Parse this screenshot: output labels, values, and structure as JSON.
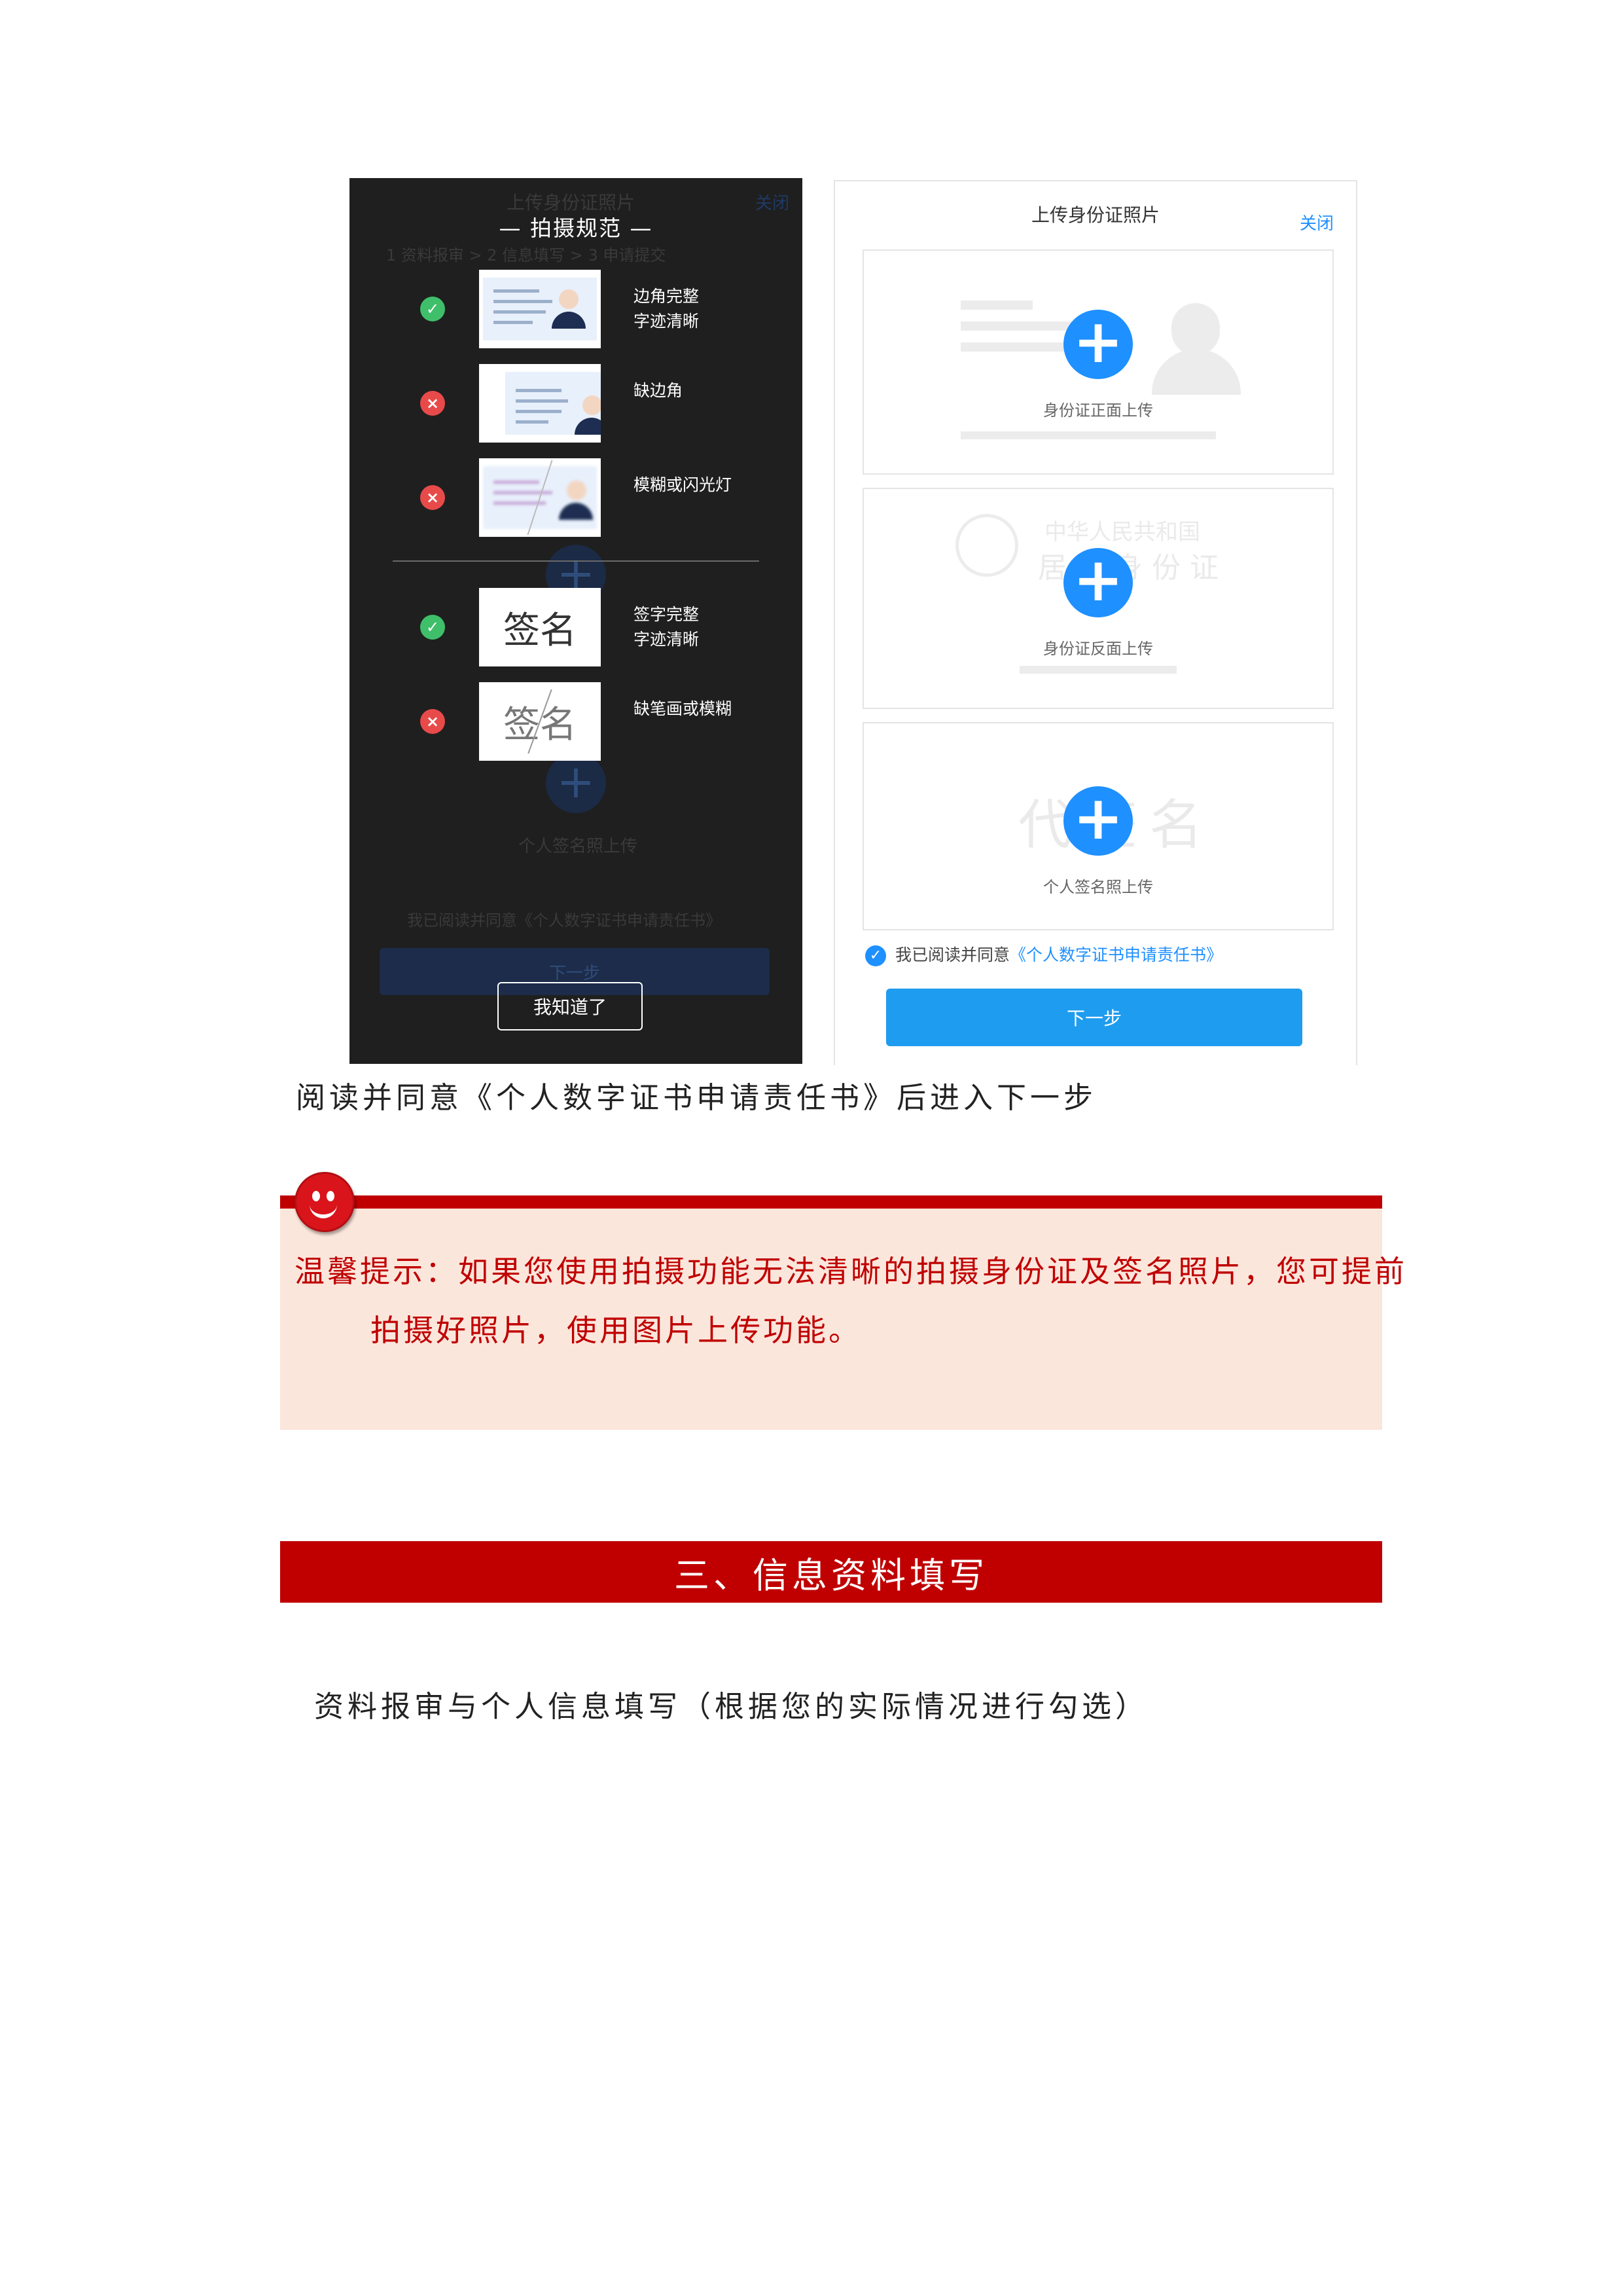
{
  "left_phone": {
    "bg_title": "上传身份证照片",
    "bg_close": "关闭",
    "bg_steps": "1 资料报审  >  2 信息填写  >  3 申请提交",
    "bg_upload_label": "个人签名照上传",
    "bg_agree": "我已阅读并同意《个人数字证书申请责任书》",
    "bg_next": "下一步",
    "guide_title": "— 拍摄规范 —",
    "rows": [
      {
        "status": "ok",
        "label_line1": "边角完整",
        "label_line2": "字迹清晰",
        "thumb": "id-card"
      },
      {
        "status": "bad",
        "label_line1": "缺边角",
        "label_line2": "",
        "thumb": "id-card-cropped"
      },
      {
        "status": "bad",
        "label_line1": "模糊或闪光灯",
        "label_line2": "",
        "thumb": "id-card-blurred"
      },
      {
        "status": "ok",
        "label_line1": "签字完整",
        "label_line2": "字迹清晰",
        "thumb": "signature",
        "sign_text": "签名"
      },
      {
        "status": "bad",
        "label_line1": "缺笔画或模糊",
        "label_line2": "",
        "thumb": "signature-broken",
        "sign_text": "签名"
      }
    ],
    "ok_button": "我知道了",
    "icons": {
      "ok": "check-circle-icon",
      "bad": "x-circle-icon"
    }
  },
  "right_phone": {
    "title": "上传身份证照片",
    "close": "关闭",
    "upload_front": "身份证正面上传",
    "upload_back": "身份证反面上传",
    "upload_sign": "个人签名照上传",
    "back_watermark_line1": "中华人民共和国",
    "back_watermark_line2": "居民身份证",
    "sign_watermark": "代签名",
    "agree_prefix": "我已阅读并同意",
    "agree_link": "《个人数字证书申请责任书》",
    "next_button": "下一步",
    "accent": "#1e90ff"
  },
  "caption": "阅读并同意《个人数字证书申请责任书》后进入下一步",
  "tip": {
    "line1": "温馨提示：如果您使用拍摄功能无法清晰的拍摄身份证及签名照片，您可提前",
    "line2": "拍摄好照片，使用图片上传功能。",
    "color": "#c00000",
    "background": "#fbe6dc"
  },
  "section": {
    "title": "三、信息资料填写",
    "subtitle": "资料报审与个人信息填写（根据您的实际情况进行勾选）"
  }
}
